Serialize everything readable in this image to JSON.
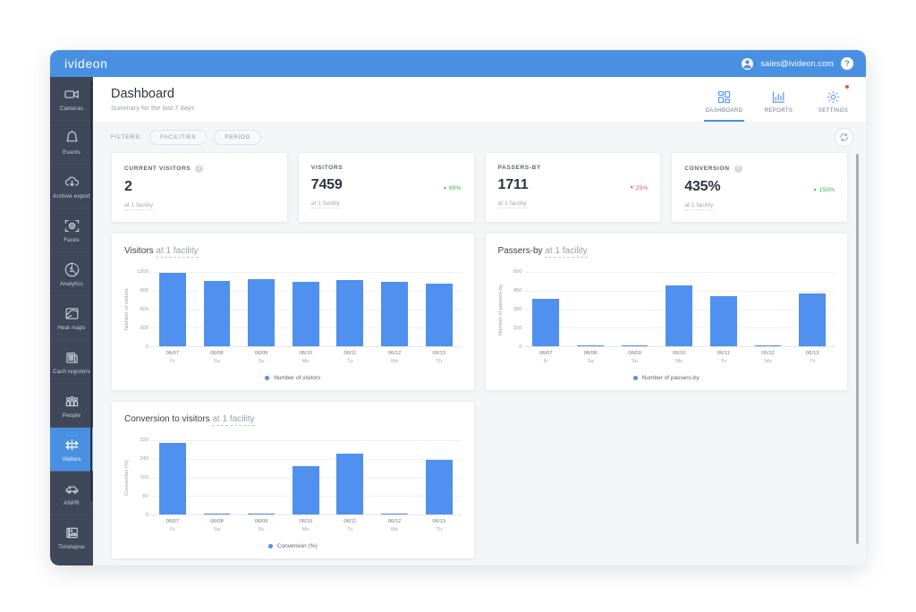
{
  "topbar": {
    "brand": "ivideon",
    "account_email": "sales@ivideon.com",
    "help_label": "?",
    "accent_color": "#4a90e2"
  },
  "sidebar": {
    "background_color": "#3f4859",
    "active_color": "#4a90e2",
    "items": [
      {
        "label": "Cameras",
        "icon": "video-camera-icon",
        "active": false
      },
      {
        "label": "Events",
        "icon": "bell-icon",
        "active": false
      },
      {
        "label": "Archive export",
        "icon": "cloud-download-icon",
        "active": false
      },
      {
        "label": "Faces",
        "icon": "face-detect-icon",
        "active": false
      },
      {
        "label": "Analytics",
        "icon": "analytics-pie-icon",
        "active": false
      },
      {
        "label": "Heat maps",
        "icon": "heat-map-icon",
        "active": false
      },
      {
        "label": "Cash registers",
        "icon": "cash-register-icon",
        "active": false
      },
      {
        "label": "People",
        "icon": "people-icon",
        "active": false
      },
      {
        "label": "Visitors",
        "icon": "visitors-arrows-icon",
        "active": true
      },
      {
        "label": "ANPR",
        "icon": "car-icon",
        "active": false
      },
      {
        "label": "Timelapse",
        "icon": "timelapse-icon",
        "active": false
      }
    ]
  },
  "page_header": {
    "title": "Dashboard",
    "subtitle": "Summary for the last 7 days",
    "tabs": [
      {
        "label": "DASHBOARD",
        "icon": "dashboard-grid-icon",
        "active": true,
        "badge": false
      },
      {
        "label": "REPORTS",
        "icon": "bar-chart-icon",
        "active": false,
        "badge": false
      },
      {
        "label": "SETTINGS",
        "icon": "gear-icon",
        "active": false,
        "badge": true
      }
    ]
  },
  "filters": {
    "label": "FILTERS:",
    "chips": [
      {
        "label": "FACILITIES"
      },
      {
        "label": "PERIOD"
      }
    ],
    "refresh_icon": "refresh-icon"
  },
  "kpis": [
    {
      "title": "CURRENT VISITORS",
      "has_info": true,
      "info_glyph": "?",
      "value": "2",
      "delta": "",
      "delta_dir": "none",
      "subtitle": "at 1 facility"
    },
    {
      "title": "VISITORS",
      "has_info": false,
      "info_glyph": "?",
      "value": "7459",
      "delta": "89%",
      "delta_dir": "up",
      "delta_glyph": "▲",
      "subtitle": "at 1 facility"
    },
    {
      "title": "PASSERS-BY",
      "has_info": false,
      "info_glyph": "?",
      "value": "1711",
      "delta": "25%",
      "delta_dir": "down",
      "delta_glyph": "▼",
      "subtitle": "at 1 facility"
    },
    {
      "title": "CONVERSION",
      "has_info": true,
      "info_glyph": "?",
      "value": "435%",
      "delta": "150%",
      "delta_dir": "up",
      "delta_glyph": "▲",
      "subtitle": "at 1 facility"
    }
  ],
  "colors": {
    "bar": "#5090ee",
    "delta_up": "#3ab44a",
    "delta_down": "#e2574c",
    "badge_red": "#f0503c"
  },
  "chart_data": [
    {
      "type": "bar",
      "card_id": "visitors",
      "title": "Visitors",
      "title_suffix": "at 1 facility",
      "categories": [
        "06/07",
        "06/08",
        "06/09",
        "06/10",
        "06/11",
        "06/12",
        "06/13"
      ],
      "category_days": [
        "Fr",
        "Sa",
        "Su",
        "Mo",
        "Tu",
        "We",
        "Th"
      ],
      "values": [
        1180,
        1050,
        1080,
        1040,
        1075,
        1045,
        1015
      ],
      "xlabel": "",
      "ylabel": "Number of visitors",
      "ylim": [
        0,
        1200
      ],
      "yticks": [
        0,
        300,
        600,
        900,
        1200
      ],
      "grid": true,
      "legend": [
        "Number of visitors"
      ],
      "legend_position": "bottom"
    },
    {
      "type": "bar",
      "card_id": "passers-by",
      "title": "Passers-by",
      "title_suffix": "at 1 facility",
      "categories": [
        "06/07",
        "06/08",
        "06/09",
        "06/10",
        "06/11",
        "06/12",
        "06/13"
      ],
      "category_days": [
        "Fr",
        "Sa",
        "Su",
        "Mo",
        "Tu",
        "We",
        "Th"
      ],
      "values": [
        380,
        4,
        4,
        490,
        405,
        4,
        430
      ],
      "xlabel": "",
      "ylabel": "Number of passers-by",
      "ylim": [
        0,
        600
      ],
      "yticks": [
        0,
        150,
        300,
        450,
        600
      ],
      "grid": true,
      "legend": [
        "Number of passers-by"
      ],
      "legend_position": "bottom"
    },
    {
      "type": "bar",
      "card_id": "conversion",
      "title": "Conversion to visitors",
      "title_suffix": "at 1 facility",
      "categories": [
        "06/07",
        "06/08",
        "06/09",
        "06/10",
        "06/11",
        "06/12",
        "06/13"
      ],
      "category_days": [
        "Fr",
        "Sa",
        "Su",
        "Mo",
        "Tu",
        "We",
        "Th"
      ],
      "values": [
        310,
        3,
        3,
        210,
        262,
        3,
        235
      ],
      "xlabel": "",
      "ylabel": "Conversion (%)",
      "ylim": [
        0,
        320
      ],
      "yticks": [
        0,
        80,
        160,
        240,
        320
      ],
      "grid": true,
      "legend": [
        "Conversion (%)"
      ],
      "legend_position": "bottom"
    }
  ]
}
